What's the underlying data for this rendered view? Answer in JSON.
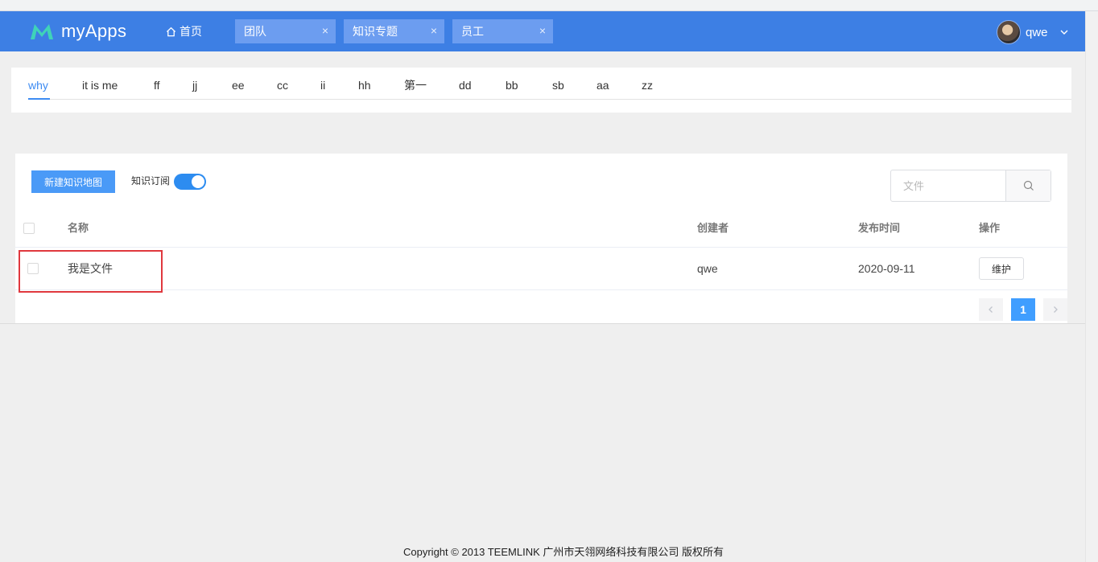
{
  "header": {
    "logo_text": "myApps",
    "home_label": "首页",
    "tabs": [
      {
        "label": "团队"
      },
      {
        "label": "知识专题"
      },
      {
        "label": "员工"
      }
    ],
    "tab_close_glyph": "×",
    "user_name": "qwe",
    "colors": {
      "bar": "#3d7fe4",
      "tab": "#6c9df0",
      "logo_mark": "#3fd3b8"
    }
  },
  "categories": {
    "items": [
      "why",
      "it is me",
      "ff",
      "jj",
      "ee",
      "cc",
      "ii",
      "hh",
      "第一",
      "dd",
      "bb",
      "sb",
      "aa",
      "zz"
    ],
    "active_index": 0
  },
  "toolbar": {
    "new_button": "新建知识地图",
    "subscribe_label": "知识订阅",
    "subscribe_on": true,
    "search_placeholder": "文件"
  },
  "table": {
    "headers": {
      "name": "名称",
      "creator": "创建者",
      "published": "发布时间",
      "action": "操作"
    },
    "rows": [
      {
        "name": "我是文件",
        "creator": "qwe",
        "published": "2020-09-11",
        "action": "维护"
      }
    ]
  },
  "pagination": {
    "current": "1"
  },
  "footer": {
    "copyright": "Copyright © 2013 TEEMLINK 广州市天翎网络科技有限公司 版权所有"
  }
}
